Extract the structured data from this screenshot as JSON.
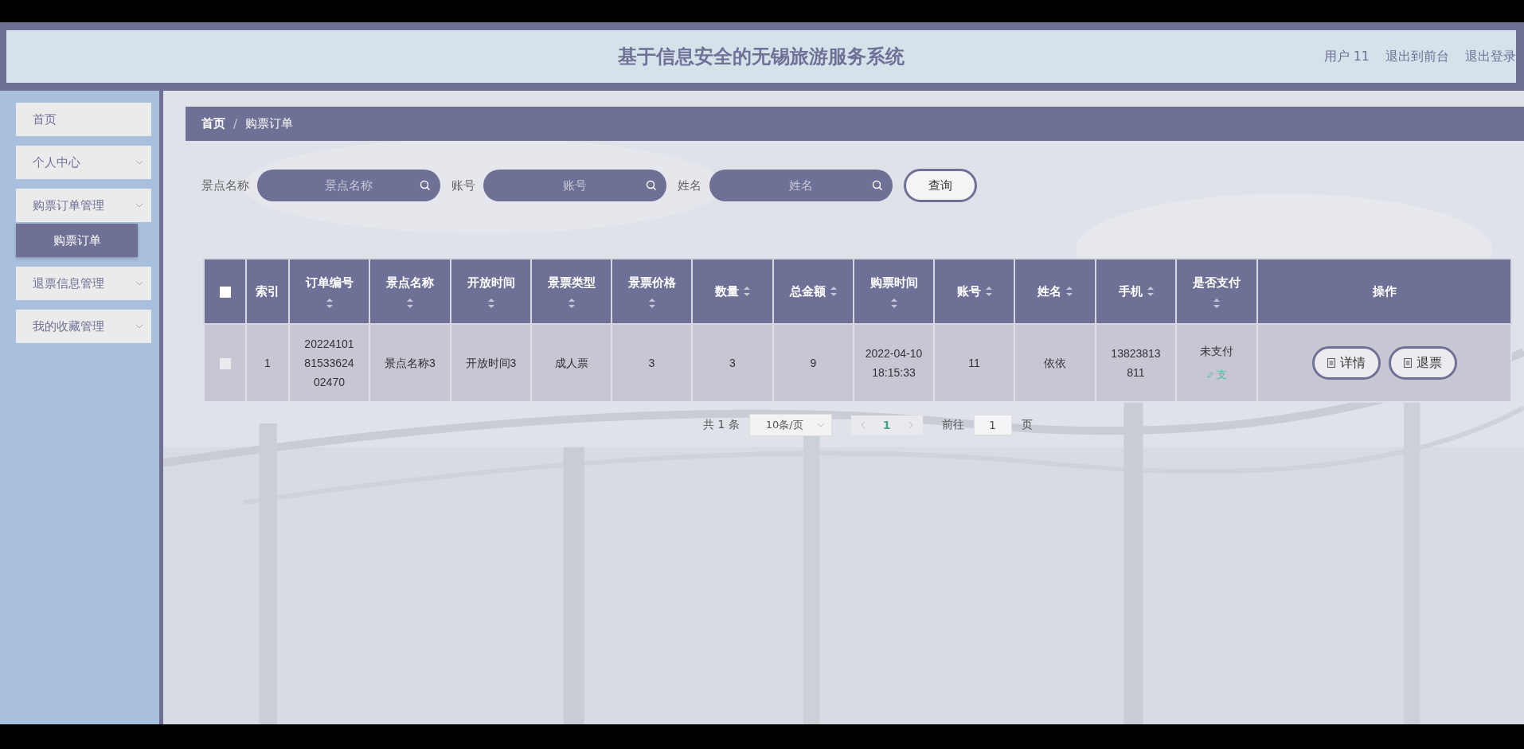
{
  "header": {
    "title": "基于信息安全的无锡旅游服务系统",
    "links": [
      "用户 11",
      "退出到前台",
      "退出登录"
    ]
  },
  "sidebar": {
    "items": [
      {
        "label": "首页",
        "expandable": false
      },
      {
        "label": "个人中心",
        "expandable": true
      },
      {
        "label": "购票订单管理",
        "expandable": true,
        "children": [
          {
            "label": "购票订单",
            "selected": true
          }
        ]
      },
      {
        "label": "退票信息管理",
        "expandable": true
      },
      {
        "label": "我的收藏管理",
        "expandable": true
      }
    ]
  },
  "breadcrumb": [
    "首页",
    "/",
    "购票订单"
  ],
  "search": {
    "fields": [
      {
        "label": "景点名称",
        "placeholder": "景点名称"
      },
      {
        "label": "账号",
        "placeholder": "账号"
      },
      {
        "label": "姓名",
        "placeholder": "姓名"
      }
    ],
    "button": "查询"
  },
  "table": {
    "select_all_checked": false,
    "columns": [
      {
        "label": "索引",
        "sortable": false
      },
      {
        "label": "订单编号",
        "sortable": true
      },
      {
        "label": "景点名称",
        "sortable": true
      },
      {
        "label": "开放时间",
        "sortable": true
      },
      {
        "label": "景票类型",
        "sortable": true
      },
      {
        "label": "景票价格",
        "sortable": true
      },
      {
        "label": "数量",
        "sortable": true
      },
      {
        "label": "总金额",
        "sortable": true
      },
      {
        "label": "购票时间",
        "sortable": true
      },
      {
        "label": "账号",
        "sortable": true
      },
      {
        "label": "姓名",
        "sortable": true
      },
      {
        "label": "手机",
        "sortable": true
      },
      {
        "label": "是否支付",
        "sortable": true
      },
      {
        "label": "操作",
        "sortable": false
      }
    ],
    "rows": [
      {
        "checked": false,
        "cells": [
          "1",
          "202241018153362402470",
          "景点名称3",
          "开放时间3",
          "成人票",
          "3",
          "3",
          "9",
          "2022-04-10 18:15:33",
          "11",
          "依依",
          "13823813811"
        ],
        "payment": {
          "status": "未支付",
          "link": "支"
        },
        "actions": [
          "详情",
          "退票"
        ]
      }
    ]
  },
  "pagination": {
    "total": "共 1 条",
    "page_size": "10条/页",
    "pages": [
      {
        "label": "1",
        "selected": true
      }
    ],
    "goto_label": "前往",
    "goto_value": "1",
    "page_suffix": "页"
  }
}
